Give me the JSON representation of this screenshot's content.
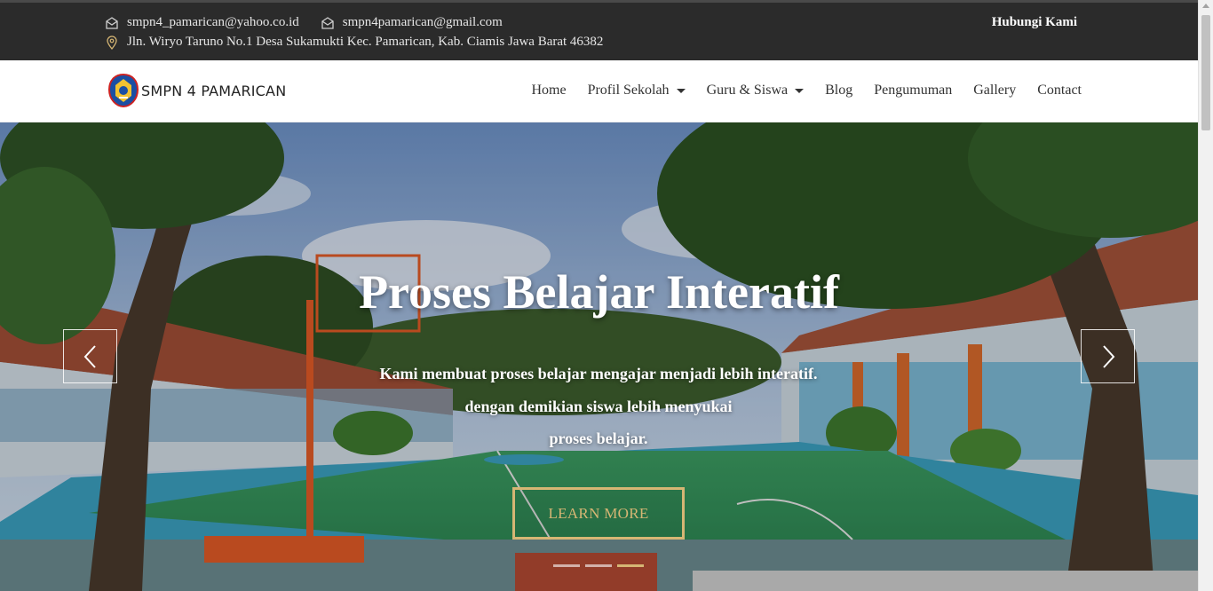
{
  "topbar": {
    "email1": "smpn4_pamarican@yahoo.co.id",
    "email2": "smpn4pamarican@gmail.com",
    "address": "Jln. Wiryo Taruno No.1 Desa Sukamukti Kec. Pamarican, Kab. Ciamis Jawa Barat 46382",
    "contact_link": "Hubungi Kami"
  },
  "navbar": {
    "brand": "SMPN 4 PAMARICAN",
    "menu": [
      {
        "label": "Home",
        "dropdown": false
      },
      {
        "label": "Profil Sekolah",
        "dropdown": true
      },
      {
        "label": "Guru & Siswa",
        "dropdown": true
      },
      {
        "label": "Blog",
        "dropdown": false
      },
      {
        "label": "Pengumuman",
        "dropdown": false
      },
      {
        "label": "Gallery",
        "dropdown": false
      },
      {
        "label": "Contact",
        "dropdown": false
      }
    ]
  },
  "hero": {
    "title": "Proses Belajar Interatif",
    "lines": [
      "Kami membuat proses belajar mengajar menjadi lebih interatif.",
      "dengan demikian siswa lebih menyukai",
      "proses belajar."
    ],
    "button": "LEARN MORE",
    "slides_count": 3,
    "active_slide": 3
  },
  "colors": {
    "topbar_bg": "#2b2b2b",
    "accent": "#d6b674",
    "nav_text": "#333333"
  },
  "icons": [
    "envelope-icon",
    "map-pin-icon",
    "chevron-left-icon",
    "chevron-right-icon",
    "school-logo-icon"
  ]
}
